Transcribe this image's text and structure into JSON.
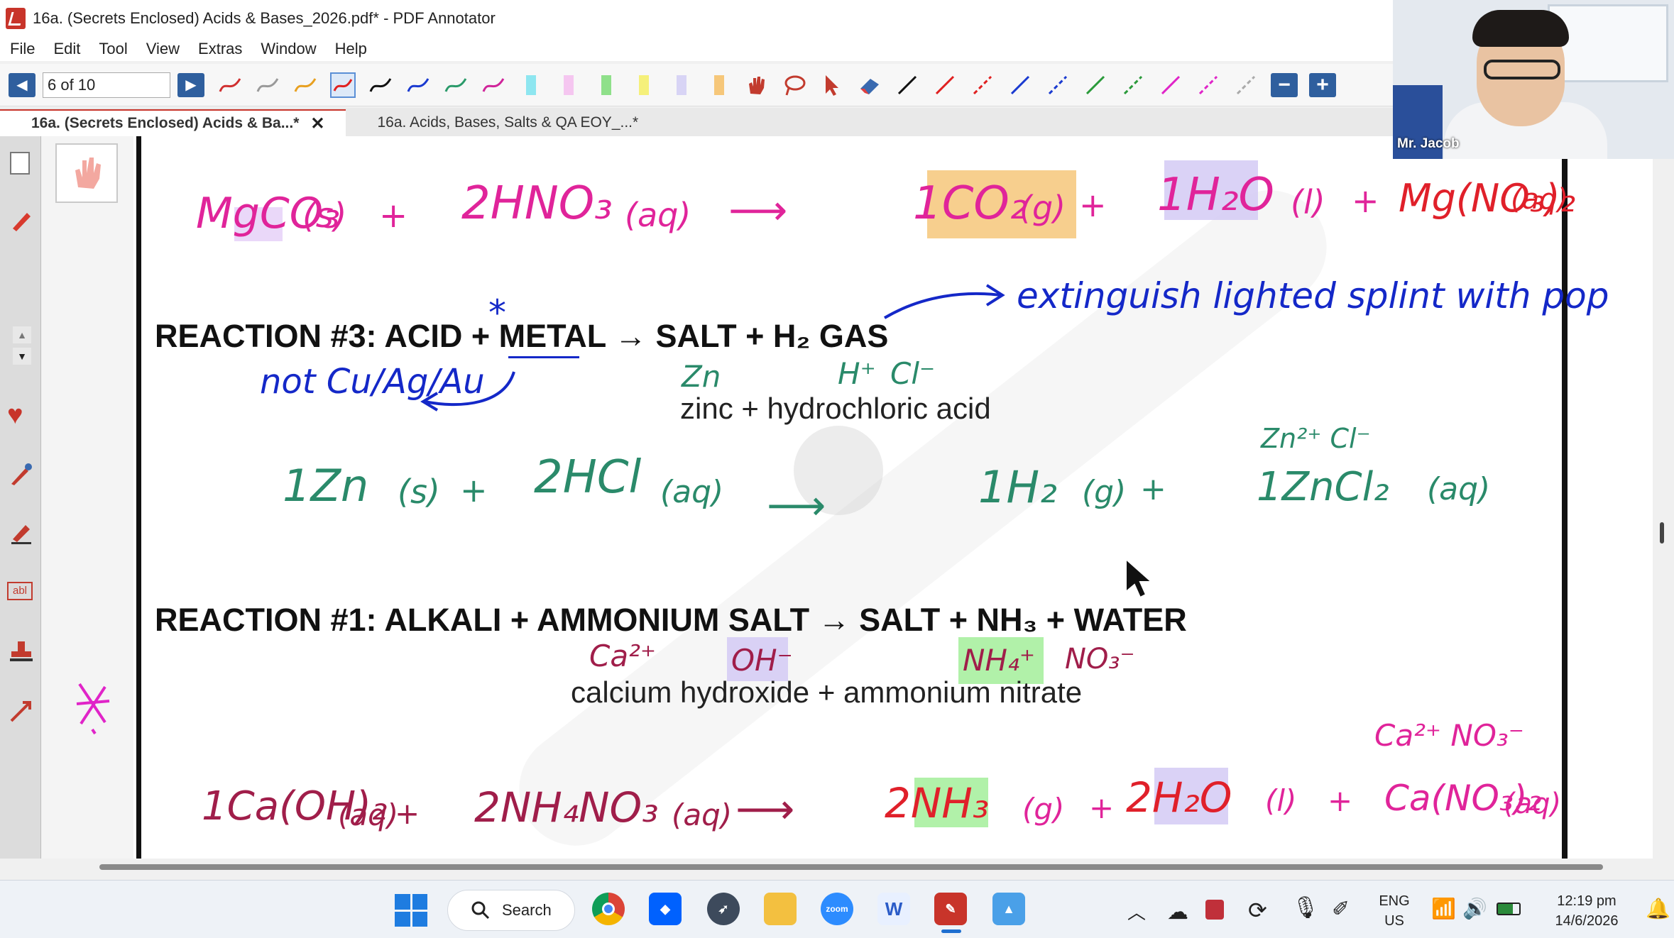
{
  "window": {
    "title": "16a. (Secrets Enclosed) Acids & Bases_2026.pdf* - PDF Annotator"
  },
  "menu": [
    "File",
    "Edit",
    "Tool",
    "View",
    "Extras",
    "Window",
    "Help"
  ],
  "toolbar": {
    "page_field": "6 of 10"
  },
  "tabs": [
    {
      "label": "16a. (Secrets Enclosed) Acids & Ba...*",
      "close": "✕"
    },
    {
      "label": "16a. Acids, Bases, Salts & QA EOY_...*"
    }
  ],
  "document": {
    "eq1": {
      "reactant1": "MgCO₃",
      "state1": "(s)",
      "plus1": "+",
      "reactant2": "2HNO₃",
      "state2": "(aq)",
      "arrow": "⟶",
      "product1": "1CO₂",
      "pstate1": "(g)",
      "plus2": "+",
      "product2": "1H₂O",
      "pstate2": "(l)",
      "plus3": "+",
      "product3": "Mg(NO₃)₂",
      "pstate3": "(aq)"
    },
    "reaction3": {
      "heading": "REACTION #3: ACID + METAL → SALT + H₂ GAS",
      "star": "*",
      "note_metal": "not Cu/Ag/Au",
      "note_h2": "extinguish lighted splint with pop",
      "ion_zn": "Zn",
      "ion_h": "H⁺",
      "ion_cl": "Cl⁻",
      "ion_zncl": "Zn²⁺ Cl⁻",
      "subtitle": "zinc + hydrochloric acid",
      "eq": {
        "r1": "1Zn",
        "s1": "(s)",
        "plus1": "+",
        "r2": "2HCl",
        "s2": "(aq)",
        "arrow": "⟶",
        "p1": "1H₂",
        "ps1": "(g)",
        "plus2": "+",
        "p2": "1ZnCl₂",
        "ps2": "(aq)"
      }
    },
    "reaction1": {
      "heading": "REACTION #1: ALKALI + AMMONIUM SALT → SALT + NH₃ + WATER",
      "ion_ca": "Ca²⁺",
      "ion_oh": "OH⁻",
      "ion_nh4": "NH₄⁺",
      "ion_no3": "NO₃⁻",
      "ion_cano3": "Ca²⁺ NO₃⁻",
      "subtitle": "calcium hydroxide + ammonium nitrate",
      "eq": {
        "r1": "1Ca(OH)₂",
        "s1": "(aq)",
        "plus1": "+",
        "r2": "2NH₄NO₃",
        "s2": "(aq)",
        "arrow": "⟶",
        "p1": "2NH₃",
        "ps1": "(g)",
        "plus2": "+",
        "p2": "2H₂O",
        "ps2": "(l)",
        "plus3": "+",
        "p3": "Ca(NO₃)₂",
        "ps3": "(aq)"
      }
    }
  },
  "webcam": {
    "name": "Mr. Jacob"
  },
  "taskbar": {
    "search_label": "Search",
    "language": "ENG",
    "region": "US",
    "time": "12:19 pm",
    "date": "14/6/2026"
  },
  "colors": {
    "accent_red": "#c8342a",
    "ink_magenta": "#e0249a",
    "ink_red": "#e0202a",
    "ink_blue": "#1428c8",
    "ink_green": "#2a8a6a",
    "ink_maroon": "#a01e4a",
    "hl_orange": "#f6c77a",
    "hl_purple": "#d6cdf5",
    "hl_green": "#a8f0a0"
  }
}
